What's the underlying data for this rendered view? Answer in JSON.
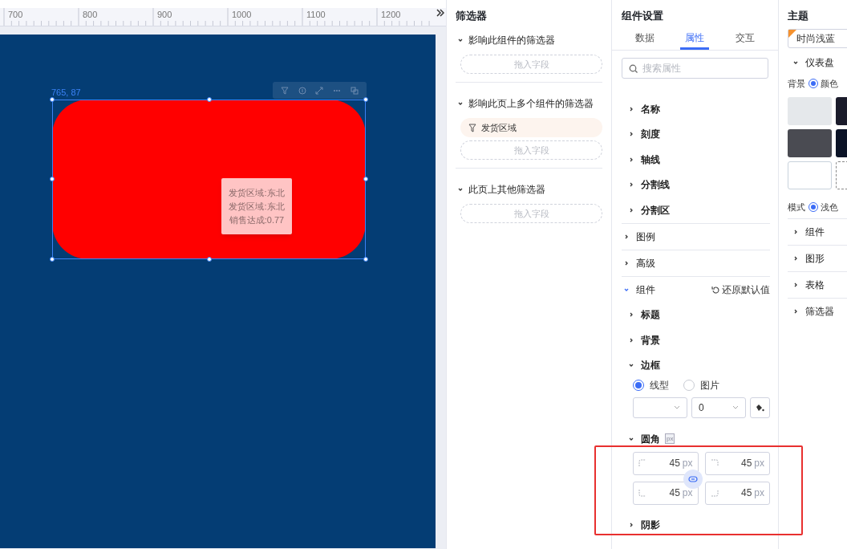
{
  "ruler": {
    "labels": [
      "700",
      "800",
      "900",
      "1000",
      "1100",
      "1200"
    ]
  },
  "canvas": {
    "position_label": "765, 87",
    "tooltip": [
      "发货区域:东北",
      "发货区域:东北",
      "销售达成:0.77"
    ]
  },
  "filter_panel": {
    "title": "筛选器",
    "sections": [
      {
        "label": "影响此组件的筛选器",
        "expanded": true,
        "drop_placeholder": "拖入字段"
      },
      {
        "label": "影响此页上多个组件的筛选器",
        "expanded": true,
        "fields": [
          "发货区域"
        ],
        "drop_placeholder": "拖入字段"
      },
      {
        "label": "此页上其他筛选器",
        "expanded": true,
        "drop_placeholder": "拖入字段"
      }
    ]
  },
  "settings": {
    "title": "组件设置",
    "tabs": [
      {
        "label": "数据",
        "selected": false
      },
      {
        "label": "属性",
        "selected": true
      },
      {
        "label": "交互",
        "selected": false
      }
    ],
    "search": {
      "placeholder": "搜索属性"
    },
    "sub_items": [
      {
        "label": "名称",
        "expanded": false
      },
      {
        "label": "刻度",
        "expanded": false
      },
      {
        "label": "轴线",
        "expanded": false
      },
      {
        "label": "分割线",
        "expanded": false
      },
      {
        "label": "分割区",
        "expanded": false
      }
    ],
    "groups": [
      {
        "label": "图例",
        "expanded": false
      },
      {
        "label": "高级",
        "expanded": false
      },
      {
        "label": "组件",
        "expanded": true,
        "action": "还原默认值",
        "children": [
          {
            "kind": "plain",
            "label": "标题",
            "expanded": false
          },
          {
            "kind": "plain",
            "label": "背景",
            "expanded": false
          },
          {
            "kind": "border",
            "label": "边框",
            "expanded": true,
            "options": [
              {
                "label": "线型",
                "selected": true
              },
              {
                "label": "图片",
                "selected": false
              }
            ],
            "width_value": "0"
          },
          {
            "kind": "radius",
            "label": "圆角",
            "expanded": true,
            "unit_badge": "px",
            "corners": [
              {
                "value": "45",
                "unit": "px"
              },
              {
                "value": "45",
                "unit": "px"
              },
              {
                "value": "45",
                "unit": "px"
              },
              {
                "value": "45",
                "unit": "px"
              }
            ]
          },
          {
            "kind": "plain",
            "label": "阴影",
            "expanded": false
          }
        ]
      }
    ]
  },
  "theme": {
    "title": "主题",
    "theme_name": "时尚浅蓝",
    "section": {
      "label": "仪表盘",
      "expanded": true
    },
    "background": {
      "label": "背景",
      "option": "颜色",
      "selected": true
    },
    "swatches": [
      {
        "color": "#e5e8eb",
        "kind": "solid"
      },
      {
        "color": "#1b1c2b",
        "kind": "solid"
      },
      {
        "color": "#4a4b52",
        "kind": "solid"
      },
      {
        "color": "#0b1326",
        "kind": "solid"
      },
      {
        "color": "#ffffff",
        "kind": "solid"
      },
      {
        "kind": "empty"
      }
    ],
    "mode": {
      "label": "模式",
      "option": "浅色",
      "selected": true
    },
    "items": [
      {
        "label": "组件",
        "expanded": false
      },
      {
        "label": "图形",
        "expanded": false
      },
      {
        "label": "表格",
        "expanded": false
      },
      {
        "label": "筛选器",
        "expanded": false
      }
    ]
  }
}
